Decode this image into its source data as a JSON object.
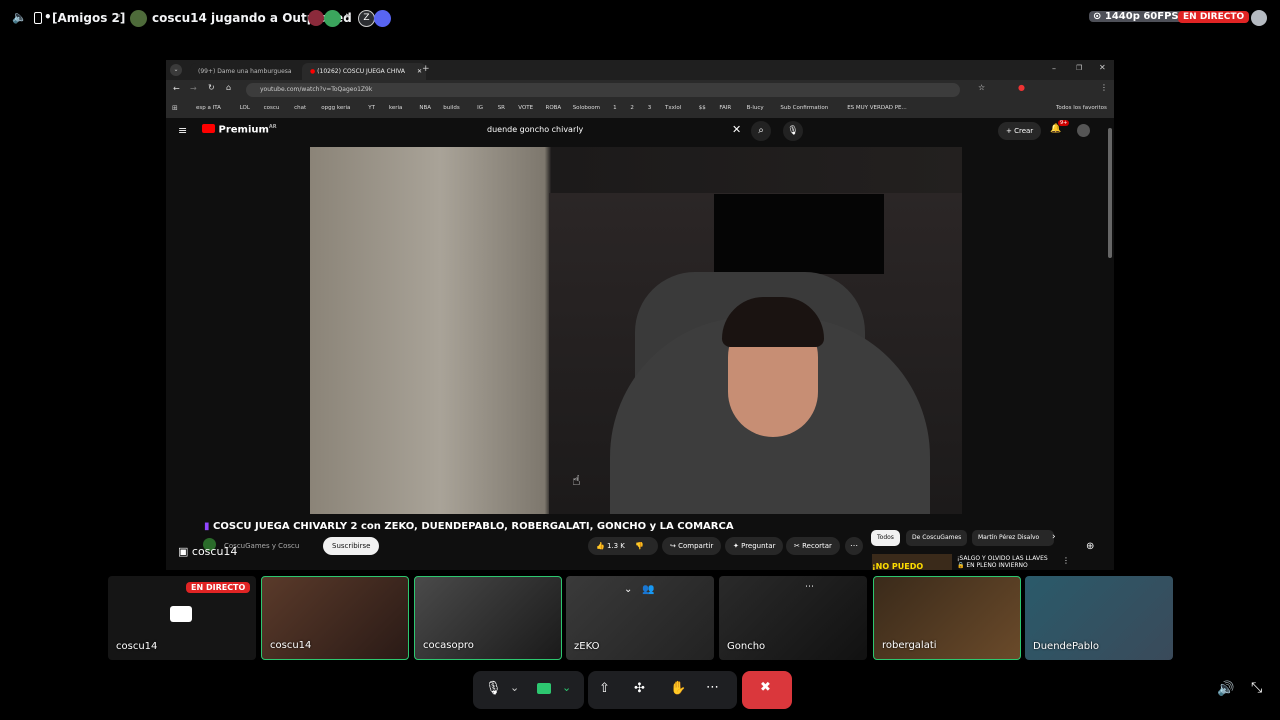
{
  "topbar": {
    "server_label": "[Amigos 2]",
    "activity": "coscu14 jugando a Outplayed",
    "quality": "1440p 60FPS",
    "live": "EN DIRECTO"
  },
  "browser": {
    "tabs": [
      "(99+) Dame una hamburguesa",
      "(10262) COSCU JUEGA CHIVA"
    ],
    "url": "youtube.com/watch?v=ToQageo1Z9k",
    "bookmarks": [
      "esp a ITA",
      "LOL",
      "coscu",
      "chat",
      "opgg keria",
      "YT",
      "keria",
      "NBA",
      "builds",
      "IG",
      "SR",
      "VOTE",
      "ROBA",
      "Soloboom",
      "1",
      "2",
      "3",
      "Txxlol",
      "$$",
      "FAIR",
      "B-lucy",
      "Sub Confirmation",
      "ES MUY VERDAD PE..."
    ],
    "all_favorites": "Todos los favoritos"
  },
  "youtube": {
    "logo": "Premium",
    "logo_sup": "AR",
    "search_value": "duende goncho chivarly",
    "create_label": "Crear",
    "notif_count": "9+",
    "video_title": "COSCU JUEGA CHIVARLY 2 con ZEKO, DUENDEPABLO, ROBERGALATI, GONCHO y LA COMARCA",
    "channel": "CoscuGames y Coscu",
    "subscribe": "Suscribirse",
    "likes": "1.3 K",
    "share": "Compartir",
    "ask": "Preguntar",
    "clip": "Recortar",
    "chips": [
      "Todos",
      "De CoscuGames",
      "Martín Pérez Disalvo"
    ],
    "side_title": "¡SALGO Y OLVIDO LAS LLAVES 🔒 EN PLENO INVIERNO",
    "side_thumb_text": "¡NO PUEDO"
  },
  "stream_label": "coscu14",
  "participants": [
    {
      "name": "coscu14",
      "live": "EN DIRECTO",
      "highlight": false
    },
    {
      "name": "coscu14",
      "highlight": true
    },
    {
      "name": "cocasopro",
      "highlight": true
    },
    {
      "name": "zEKO",
      "highlight": false
    },
    {
      "name": "Goncho",
      "highlight": false
    },
    {
      "name": "robergalati",
      "highlight": true
    },
    {
      "name": "DuendePablo",
      "highlight": false
    }
  ],
  "colors": {
    "accent_green": "#2dc770",
    "live_red": "#e02424",
    "end_red": "#da373c"
  }
}
